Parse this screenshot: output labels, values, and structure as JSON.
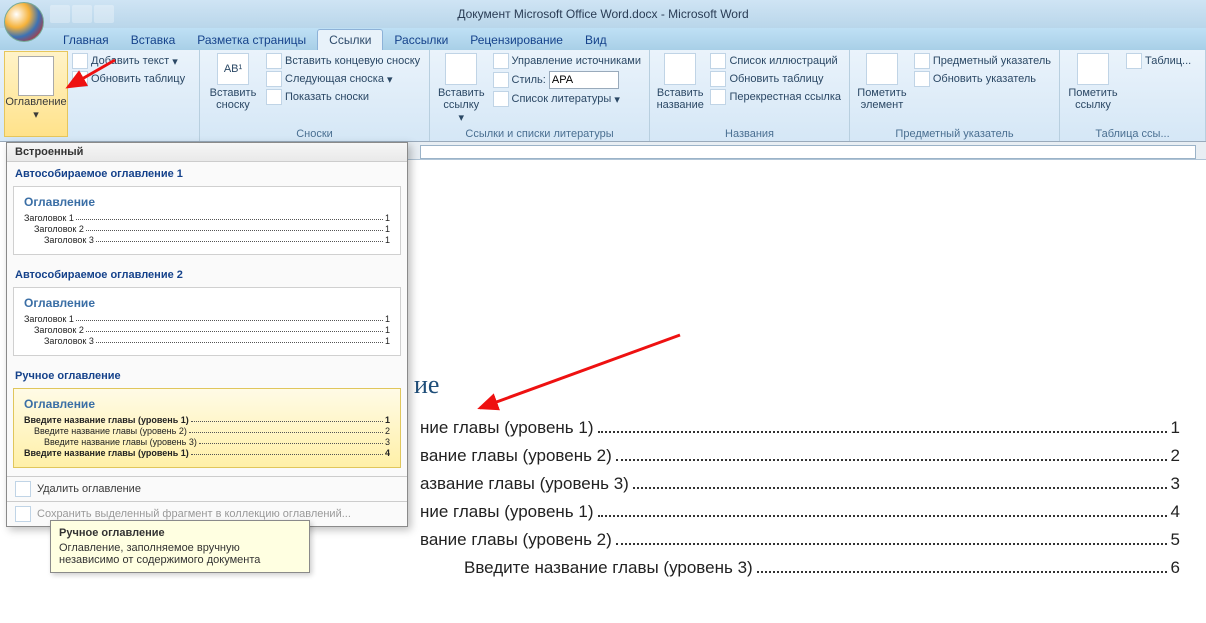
{
  "window": {
    "title": "Документ Microsoft Office Word.docx - Microsoft Word"
  },
  "tabs": [
    "Главная",
    "Вставка",
    "Разметка страницы",
    "Ссылки",
    "Рассылки",
    "Рецензирование",
    "Вид"
  ],
  "active_tab": "Ссылки",
  "ribbon": {
    "toc": {
      "btn": "Оглавление",
      "add_text": "Добавить текст",
      "update": "Обновить таблицу"
    },
    "footnotes": {
      "insert_btn": "Вставить сноску",
      "endnote": "Вставить концевую сноску",
      "next": "Следующая сноска",
      "show": "Показать сноски",
      "group": "Сноски"
    },
    "citations": {
      "insert_btn": "Вставить ссылку",
      "manage": "Управление источниками",
      "style_lbl": "Стиль:",
      "style_val": "APA",
      "biblio": "Список литературы",
      "group": "Ссылки и списки литературы"
    },
    "captions": {
      "insert_btn": "Вставить название",
      "list": "Список иллюстраций",
      "update": "Обновить таблицу",
      "crossref": "Перекрестная ссылка",
      "group": "Названия"
    },
    "index": {
      "mark_btn": "Пометить элемент",
      "index": "Предметный указатель",
      "update": "Обновить указатель",
      "group": "Предметный указатель"
    },
    "authorities": {
      "mark_btn": "Пометить ссылку",
      "table": "Таблиц...",
      "group": "Таблица ссы..."
    }
  },
  "dropdown": {
    "builtin": "Встроенный",
    "auto1_title": "Автособираемое оглавление 1",
    "auto2_title": "Автособираемое оглавление 2",
    "manual_title": "Ручное оглавление",
    "toc_heading": "Оглавление",
    "auto_lines": [
      {
        "l": "Заголовок 1",
        "p": "1"
      },
      {
        "l": "Заголовок 2",
        "p": "1"
      },
      {
        "l": "Заголовок 3",
        "p": "1"
      }
    ],
    "manual_lines": [
      {
        "l": "Введите название главы (уровень 1)",
        "p": "1"
      },
      {
        "l": "Введите название главы (уровень 2)",
        "p": "2"
      },
      {
        "l": "Введите название главы (уровень 3)",
        "p": "3"
      },
      {
        "l": "Введите название главы (уровень 1)",
        "p": "4"
      }
    ],
    "footer_remove": "Удалить оглавление",
    "footer_save": "Сохранить выделенный фрагмент в коллекцию оглавлений...",
    "tooltip_title": "Ручное оглавление",
    "tooltip_body": "Оглавление, заполняемое вручную независимо от содержимого документа"
  },
  "doc": {
    "title_partial": "ие",
    "lines": [
      {
        "t": "ние главы (уровень 1)",
        "p": "1"
      },
      {
        "t": "вание главы (уровень 2)",
        "p": "2"
      },
      {
        "t": "азвание главы (уровень 3)",
        "p": "3"
      },
      {
        "t": "ние главы (уровень 1)",
        "p": "4"
      },
      {
        "t": "вание главы (уровень 2)",
        "p": "5"
      },
      {
        "t": "Введите название главы (уровень 3)",
        "p": "6"
      }
    ]
  }
}
